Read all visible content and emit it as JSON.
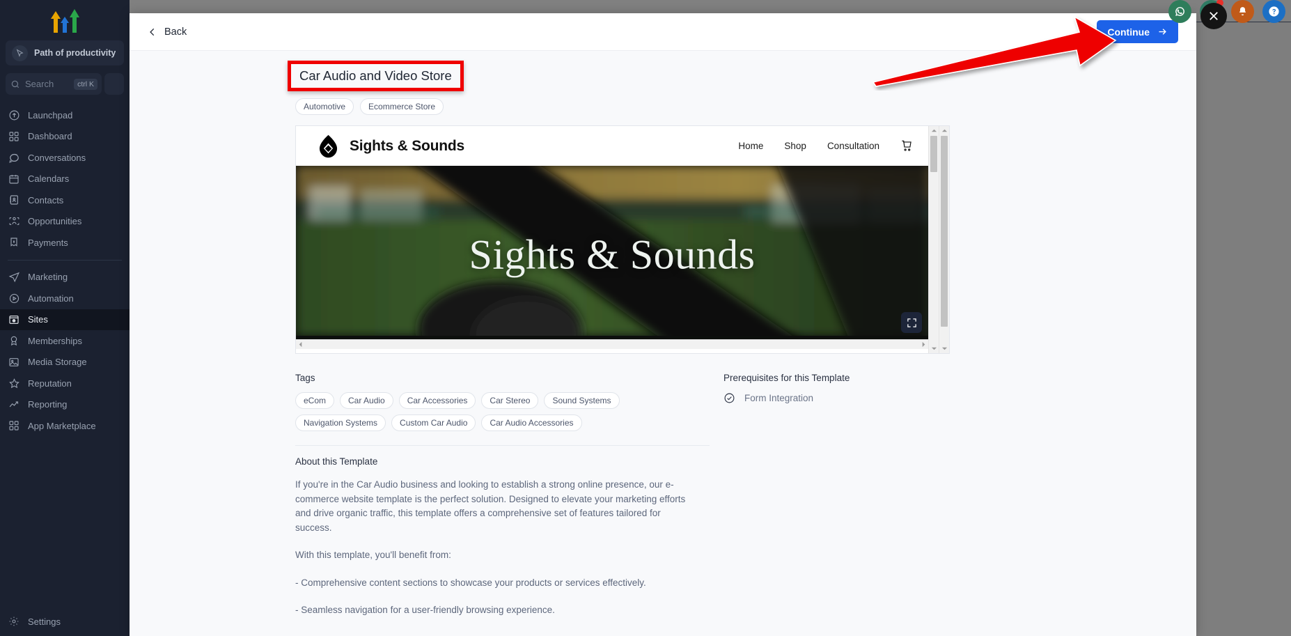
{
  "sidebar": {
    "workspace": {
      "name": "Path of productivity",
      "icon": "cursor-icon"
    },
    "search": {
      "placeholder": "Search",
      "shortcut": "ctrl K"
    },
    "items": [
      {
        "label": "Launchpad",
        "icon": "rocket-icon"
      },
      {
        "label": "Dashboard",
        "icon": "grid-icon"
      },
      {
        "label": "Conversations",
        "icon": "chat-icon"
      },
      {
        "label": "Calendars",
        "icon": "calendar-icon"
      },
      {
        "label": "Contacts",
        "icon": "contacts-icon"
      },
      {
        "label": "Opportunities",
        "icon": "opportunities-icon"
      },
      {
        "label": "Payments",
        "icon": "payments-icon"
      }
    ],
    "items2": [
      {
        "label": "Marketing",
        "icon": "send-icon",
        "active": false
      },
      {
        "label": "Automation",
        "icon": "play-circle-icon",
        "active": false
      },
      {
        "label": "Sites",
        "icon": "sites-icon",
        "active": true
      },
      {
        "label": "Memberships",
        "icon": "badge-icon",
        "active": false
      },
      {
        "label": "Media Storage",
        "icon": "image-icon",
        "active": false
      },
      {
        "label": "Reputation",
        "icon": "star-icon",
        "active": false
      },
      {
        "label": "Reporting",
        "icon": "trend-up-icon",
        "active": false
      },
      {
        "label": "App Marketplace",
        "icon": "apps-icon",
        "active": false
      }
    ],
    "settings": {
      "label": "Settings",
      "icon": "gear-icon"
    }
  },
  "topbar": {
    "fabs": [
      {
        "name": "whatsapp-fab",
        "color": "#2e7d5b",
        "badge": false
      },
      {
        "name": "announcement-fab",
        "color": "#2f7a63",
        "badge": true
      },
      {
        "name": "notifications-fab",
        "color": "#c05a19",
        "badge": false
      },
      {
        "name": "help-fab",
        "color": "#1c6fc4",
        "badge": false
      }
    ]
  },
  "modal": {
    "back_label": "Back",
    "continue_label": "Continue",
    "close_label": "Close",
    "template": {
      "title": "Car Audio and Video Store",
      "categories": [
        "Automotive",
        "Ecommerce Store"
      ],
      "preview": {
        "brand": "Sights & Sounds",
        "nav_links": [
          "Home",
          "Shop",
          "Consultation"
        ],
        "cart_icon": "cart-icon",
        "hero_title": "Sights & Sounds",
        "fullscreen_icon": "fullscreen-icon"
      },
      "tags_title": "Tags",
      "tags": [
        "eCom",
        "Car Audio",
        "Car Accessories",
        "Car Stereo",
        "Sound Systems",
        "Navigation Systems",
        "Custom Car Audio",
        "Car Audio Accessories"
      ],
      "about_title": "About this Template",
      "about_paragraphs": [
        "If you're in the Car Audio business and looking to establish a strong online presence, our e-commerce website template is the perfect solution. Designed to elevate your marketing efforts and drive organic traffic, this template offers a comprehensive set of features tailored for success.",
        "With this template, you'll benefit from:",
        "- Comprehensive content sections to showcase your products or services effectively.",
        "- Seamless navigation for a user-friendly browsing experience."
      ],
      "prereq_title": "Prerequisites for this Template",
      "prereqs": [
        {
          "label": "Form Integration",
          "icon": "check-circle-icon"
        }
      ]
    }
  },
  "annotations": {
    "highlight_color": "#ef0000",
    "arrow_color": "#ee0000",
    "accent_blue": "#1d62e8"
  }
}
